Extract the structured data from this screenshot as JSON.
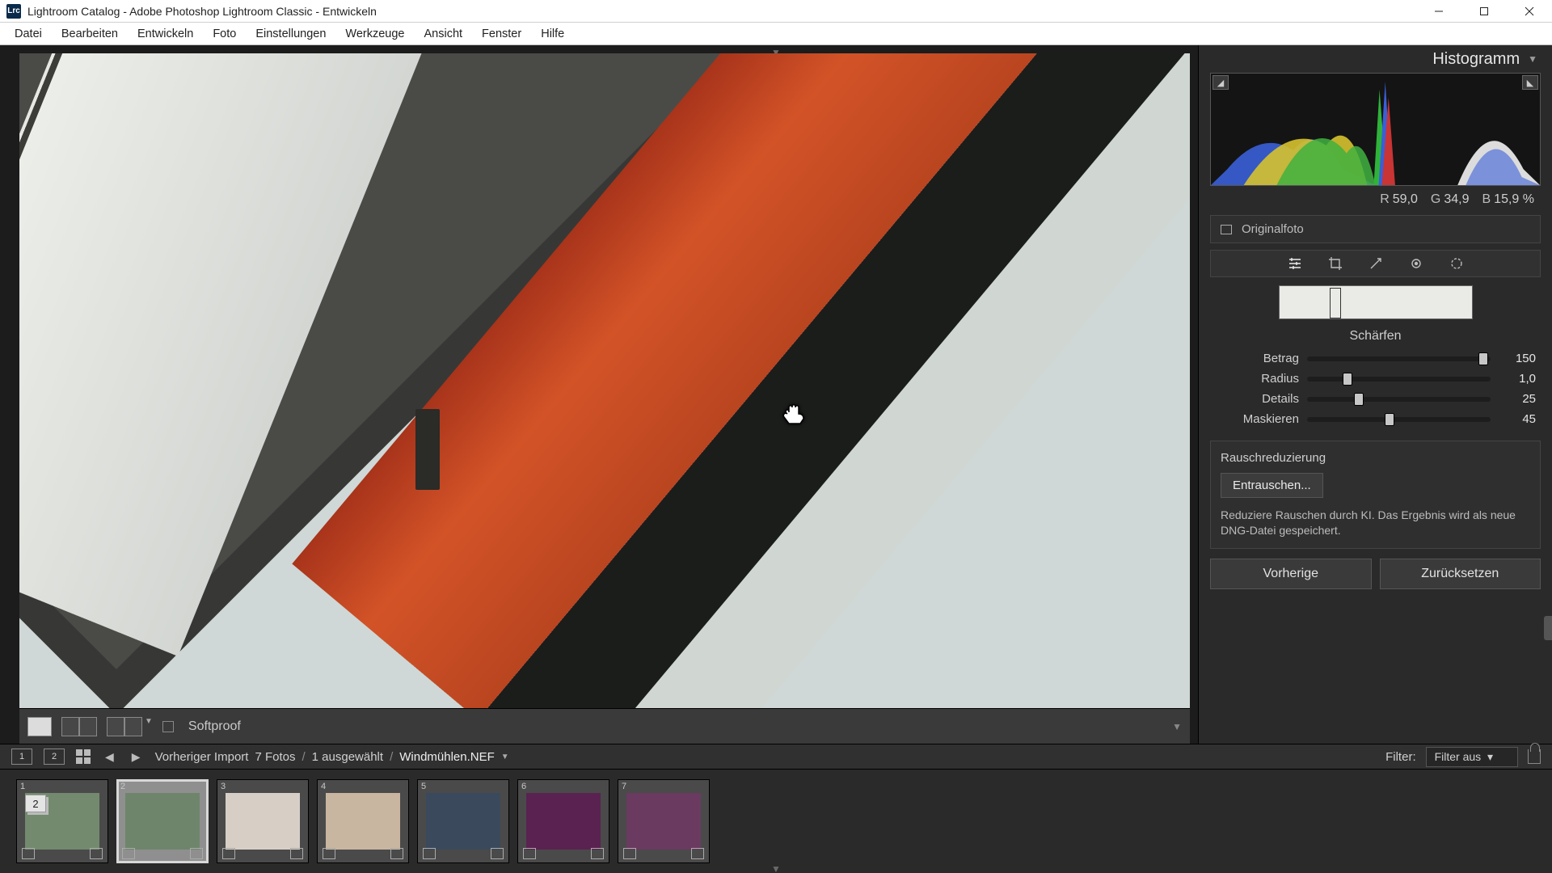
{
  "window": {
    "title": "Lightroom Catalog - Adobe Photoshop Lightroom Classic - Entwickeln",
    "app_icon_text": "Lrc"
  },
  "menu": [
    "Datei",
    "Bearbeiten",
    "Entwickeln",
    "Foto",
    "Einstellungen",
    "Werkzeuge",
    "Ansicht",
    "Fenster",
    "Hilfe"
  ],
  "toolbar": {
    "softproof_label": "Softproof"
  },
  "panel": {
    "histogram_title": "Histogramm",
    "rgb": {
      "r_label": "R",
      "r": "59,0",
      "g_label": "G",
      "g": "34,9",
      "b_label": "B",
      "b": "15,9",
      "pct": "%"
    },
    "original_label": "Originalfoto",
    "sharpen_title": "Schärfen",
    "sliders": {
      "amount": {
        "label": "Betrag",
        "value": "150",
        "pos": 96
      },
      "radius": {
        "label": "Radius",
        "value": "1,0",
        "pos": 22
      },
      "detail": {
        "label": "Details",
        "value": "25",
        "pos": 28
      },
      "mask": {
        "label": "Maskieren",
        "value": "45",
        "pos": 45
      }
    },
    "noise": {
      "title": "Rauschreduzierung",
      "button": "Entrauschen...",
      "desc": "Reduziere Rauschen durch KI. Das Ergebnis wird als neue DNG-Datei gespeichert."
    },
    "prev_btn": "Vorherige",
    "reset_btn": "Zurücksetzen"
  },
  "strip": {
    "mon1": "1",
    "mon2": "2",
    "breadcrumb": {
      "source": "Vorheriger Import",
      "count": "7 Fotos",
      "selected": "1 ausgewählt",
      "filename": "Windmühlen.NEF"
    },
    "filter_label": "Filter:",
    "filter_value": "Filter aus"
  },
  "thumbs": [
    {
      "idx": "1",
      "stack": "2",
      "color": "#738a6e"
    },
    {
      "idx": "2",
      "selected": true,
      "color": "#6e856c"
    },
    {
      "idx": "3",
      "color": "#d7cfc6"
    },
    {
      "idx": "4",
      "color": "#c9b6a0"
    },
    {
      "idx": "5",
      "color": "#3a4a5c"
    },
    {
      "idx": "6",
      "color": "#5a2250"
    },
    {
      "idx": "7",
      "color": "#6a3a60"
    }
  ]
}
